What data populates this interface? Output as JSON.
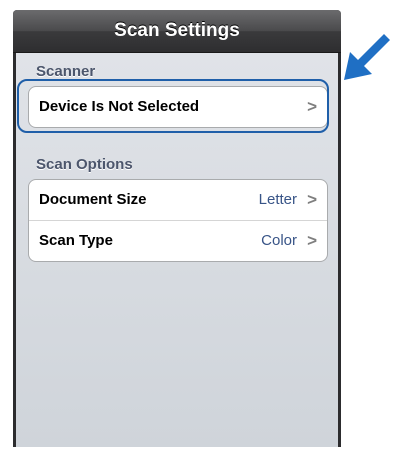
{
  "navbar": {
    "title": "Scan Settings"
  },
  "sections": {
    "scanner": {
      "header": "Scanner",
      "rows": [
        {
          "label": "Device Is Not Selected",
          "value": "",
          "chevron": ">"
        }
      ]
    },
    "scan_options": {
      "header": "Scan Options",
      "rows": [
        {
          "label": "Document Size",
          "value": "Letter",
          "chevron": ">"
        },
        {
          "label": "Scan Type",
          "value": "Color",
          "chevron": ">"
        }
      ]
    }
  },
  "annotation": {
    "highlight_color": "#1f5fa9",
    "arrow_color": "#1f6fc4",
    "arrow_icon": "pointer-arrow-icon"
  },
  "colors": {
    "navbar": "#3a3a3c",
    "background": "#d6dae0",
    "section_header": "#4c566c",
    "value_text": "#385487"
  }
}
